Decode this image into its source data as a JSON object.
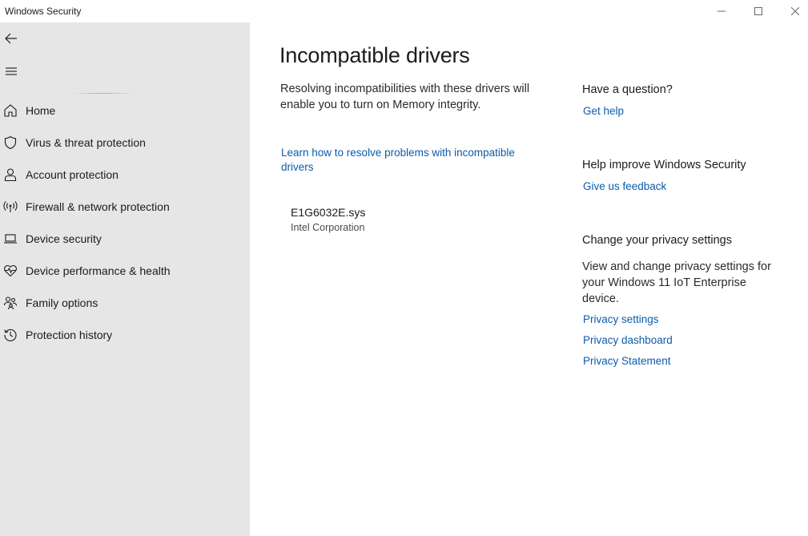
{
  "window": {
    "title": "Windows Security"
  },
  "sidebar": {
    "items": [
      {
        "label": "Home",
        "icon": "home-icon"
      },
      {
        "label": "Virus & threat protection",
        "icon": "shield-icon"
      },
      {
        "label": "Account protection",
        "icon": "person-icon"
      },
      {
        "label": "Firewall & network protection",
        "icon": "antenna-icon"
      },
      {
        "label": "Device security",
        "icon": "laptop-icon"
      },
      {
        "label": "Device performance & health",
        "icon": "heart-pulse-icon"
      },
      {
        "label": "Family options",
        "icon": "family-icon"
      },
      {
        "label": "Protection history",
        "icon": "history-icon"
      }
    ]
  },
  "main": {
    "title": "Incompatible drivers",
    "intro": "Resolving incompatibilities with these drivers will enable you to turn on Memory integrity.",
    "learn_link": "Learn how to resolve problems with incompatible drivers",
    "drivers": [
      {
        "name": "E1G6032E.sys",
        "vendor": "Intel Corporation"
      }
    ]
  },
  "aside": {
    "question": {
      "heading": "Have a question?",
      "link": "Get help"
    },
    "improve": {
      "heading": "Help improve Windows Security",
      "link": "Give us feedback"
    },
    "privacy": {
      "heading": "Change your privacy settings",
      "text": "View and change privacy settings for your Windows 11 IoT Enterprise device.",
      "links": [
        "Privacy settings",
        "Privacy dashboard",
        "Privacy Statement"
      ]
    }
  },
  "colors": {
    "sidebar_bg": "#e6e6e6",
    "link": "#0b5cad",
    "text": "#1b1b1b"
  }
}
